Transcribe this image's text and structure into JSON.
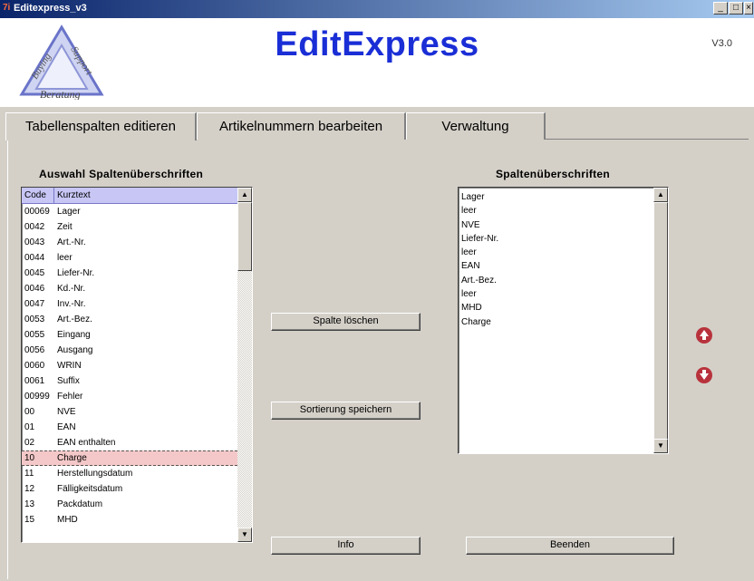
{
  "window": {
    "title": "Editexpress_v3",
    "icon_text": "7i",
    "buttons": [
      "_",
      "□",
      "×"
    ]
  },
  "header": {
    "app_title": "EditExpress",
    "version": "V3.0",
    "logo": {
      "lines": [
        "Support",
        "Buying",
        "Beratung"
      ]
    }
  },
  "tabs": [
    {
      "label": "Tabellenspalten editieren",
      "active": true
    },
    {
      "label": "Artikelnummern bearbeiten",
      "active": false
    },
    {
      "label": "Verwaltung",
      "active": false
    }
  ],
  "left_panel": {
    "title": "Auswahl Spaltenüberschriften",
    "columns": [
      "Code",
      "Kurztext"
    ],
    "rows": [
      {
        "code": "00069",
        "text": "Lager"
      },
      {
        "code": "0042",
        "text": "Zeit"
      },
      {
        "code": "0043",
        "text": "Art.-Nr."
      },
      {
        "code": "0044",
        "text": "leer"
      },
      {
        "code": "0045",
        "text": "Liefer-Nr."
      },
      {
        "code": "0046",
        "text": "Kd.-Nr."
      },
      {
        "code": "0047",
        "text": "Inv.-Nr."
      },
      {
        "code": "0053",
        "text": "Art.-Bez."
      },
      {
        "code": "0055",
        "text": "Eingang"
      },
      {
        "code": "0056",
        "text": "Ausgang"
      },
      {
        "code": "0060",
        "text": "WRIN"
      },
      {
        "code": "0061",
        "text": "Suffix"
      },
      {
        "code": "00999",
        "text": "Fehler"
      },
      {
        "code": "00",
        "text": "NVE"
      },
      {
        "code": "01",
        "text": "EAN"
      },
      {
        "code": "02",
        "text": "EAN enthalten"
      },
      {
        "code": "10",
        "text": "Charge",
        "selected": true
      },
      {
        "code": "11",
        "text": "Herstellungsdatum"
      },
      {
        "code": "12",
        "text": "Fälligkeitsdatum"
      },
      {
        "code": "13",
        "text": "Packdatum"
      },
      {
        "code": "15",
        "text": "MHD"
      }
    ]
  },
  "middle_buttons": {
    "delete_column": "Spalte löschen",
    "save_sort": "Sortierung speichern",
    "info": "Info"
  },
  "right_panel": {
    "title": "Spaltenüberschriften",
    "items": [
      "Lager",
      "leer",
      "NVE",
      "Liefer-Nr.",
      "leer",
      "EAN",
      "Art.-Bez.",
      "leer",
      "MHD",
      "Charge"
    ],
    "exit": "Beenden"
  },
  "colors": {
    "accent_title": "#1a2ed6",
    "arrow": "#b8323c",
    "selected_row": "#f4c8c8",
    "list_header": "#c7c6f5"
  }
}
